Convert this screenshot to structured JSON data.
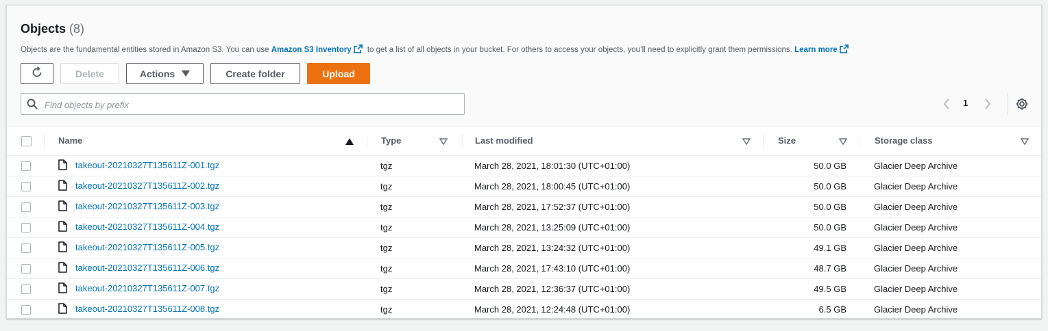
{
  "header": {
    "title": "Objects",
    "count": "(8)",
    "description_part1": "Objects are the fundamental entities stored in Amazon S3. You can use",
    "inventory_link": "Amazon S3 Inventory",
    "description_part2": "to get a list of all objects in your bucket. For others to access your objects, you’ll need to explicitly grant them permissions.",
    "learn_more": "Learn more"
  },
  "toolbar": {
    "refresh_icon": "refresh-icon",
    "delete_label": "Delete",
    "actions_label": "Actions",
    "create_folder_label": "Create folder",
    "upload_label": "Upload",
    "upload_color": "#ec7211"
  },
  "search": {
    "placeholder": "Find objects by prefix",
    "value": ""
  },
  "pagination": {
    "current_page": "1"
  },
  "table": {
    "columns": {
      "name": "Name",
      "type": "Type",
      "last_modified": "Last modified",
      "size": "Size",
      "storage_class": "Storage class"
    },
    "rows": [
      {
        "name": "takeout-20210327T135611Z-001.tgz",
        "type": "tgz",
        "last_modified": "March 28, 2021, 18:01:30 (UTC+01:00)",
        "size": "50.0 GB",
        "storage_class": "Glacier Deep Archive"
      },
      {
        "name": "takeout-20210327T135611Z-002.tgz",
        "type": "tgz",
        "last_modified": "March 28, 2021, 18:00:45 (UTC+01:00)",
        "size": "50.0 GB",
        "storage_class": "Glacier Deep Archive"
      },
      {
        "name": "takeout-20210327T135611Z-003.tgz",
        "type": "tgz",
        "last_modified": "March 28, 2021, 17:52:37 (UTC+01:00)",
        "size": "50.0 GB",
        "storage_class": "Glacier Deep Archive"
      },
      {
        "name": "takeout-20210327T135611Z-004.tgz",
        "type": "tgz",
        "last_modified": "March 28, 2021, 13:25:09 (UTC+01:00)",
        "size": "50.0 GB",
        "storage_class": "Glacier Deep Archive"
      },
      {
        "name": "takeout-20210327T135611Z-005.tgz",
        "type": "tgz",
        "last_modified": "March 28, 2021, 13:24:32 (UTC+01:00)",
        "size": "49.1 GB",
        "storage_class": "Glacier Deep Archive"
      },
      {
        "name": "takeout-20210327T135611Z-006.tgz",
        "type": "tgz",
        "last_modified": "March 28, 2021, 17:43:10 (UTC+01:00)",
        "size": "48.7 GB",
        "storage_class": "Glacier Deep Archive"
      },
      {
        "name": "takeout-20210327T135611Z-007.tgz",
        "type": "tgz",
        "last_modified": "March 28, 2021, 12:36:37 (UTC+01:00)",
        "size": "49.5 GB",
        "storage_class": "Glacier Deep Archive"
      },
      {
        "name": "takeout-20210327T135611Z-008.tgz",
        "type": "tgz",
        "last_modified": "March 28, 2021, 12:24:48 (UTC+01:00)",
        "size": "6.5 GB",
        "storage_class": "Glacier Deep Archive"
      }
    ]
  }
}
